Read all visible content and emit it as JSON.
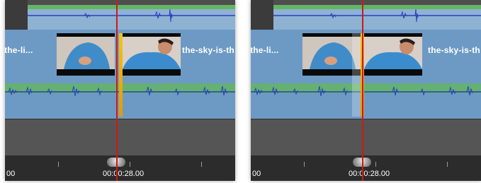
{
  "panels": [
    {
      "clip_label_left": "s-the-li...",
      "clip_label_right": "the-sky-is-th",
      "timecode": "00:00:28.00",
      "ruler_start": "00"
    },
    {
      "clip_label_left": "s-the-li...",
      "clip_label_right": "the-sky-is-th",
      "timecode": "00:00:28.00",
      "ruler_start": "00"
    }
  ],
  "colors": {
    "clip": "#6d9ac4",
    "audio_wave": "#2a3fbf",
    "volume_lane": "#64b564",
    "edit_bar": "#f6b20f",
    "playhead": "#d01818"
  },
  "icons": [
    "scrubber-handle-icon"
  ]
}
